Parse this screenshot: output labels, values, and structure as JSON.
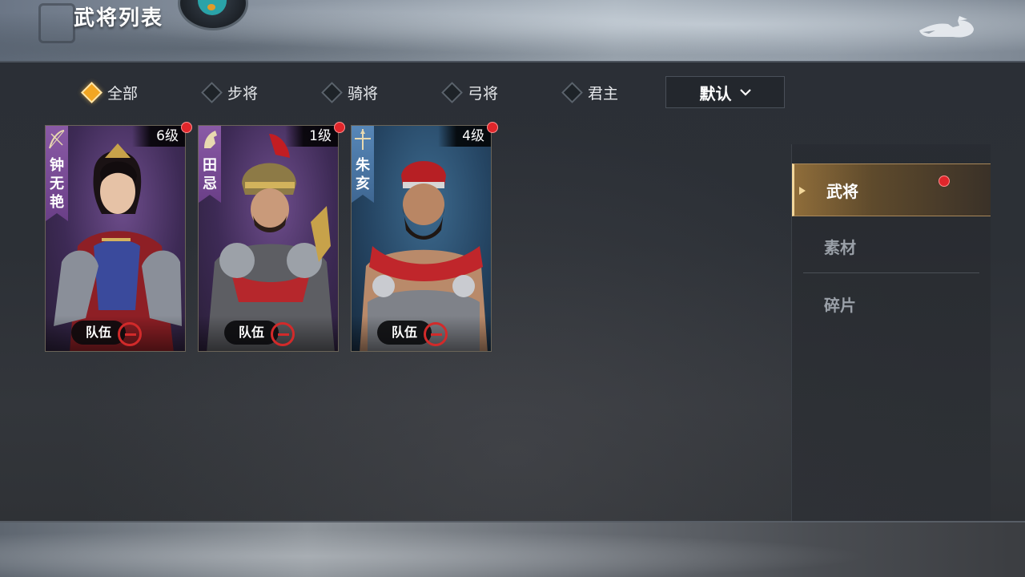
{
  "header": {
    "title": "武将列表",
    "back_icon": "dragon-back-arrow-icon"
  },
  "filters": {
    "tabs": [
      {
        "label": "全部",
        "active": true
      },
      {
        "label": "步将",
        "active": false
      },
      {
        "label": "骑将",
        "active": false
      },
      {
        "label": "弓将",
        "active": false
      },
      {
        "label": "君主",
        "active": false
      }
    ],
    "sort": {
      "label": "默认"
    }
  },
  "heroes": [
    {
      "name": "钟无艳",
      "level": "6级",
      "team_label": "队伍",
      "team_number": "一",
      "type_icon": "bow-icon",
      "theme": "purple",
      "has_new": true
    },
    {
      "name": "田忌",
      "level": "1级",
      "team_label": "队伍",
      "team_number": "一",
      "type_icon": "horse-icon",
      "theme": "purple",
      "has_new": true
    },
    {
      "name": "朱亥",
      "level": "4级",
      "team_label": "队伍",
      "team_number": "一",
      "type_icon": "spear-icon",
      "theme": "blue",
      "has_new": true
    }
  ],
  "side_menu": {
    "items": [
      {
        "label": "武将",
        "active": true,
        "has_new": true
      },
      {
        "label": "素材",
        "active": false,
        "has_new": false
      },
      {
        "label": "碎片",
        "active": false,
        "has_new": false
      }
    ]
  },
  "colors": {
    "accent_gold": "#f2a623",
    "notify_red": "#e0262b",
    "team_red": "#d22a2a"
  }
}
